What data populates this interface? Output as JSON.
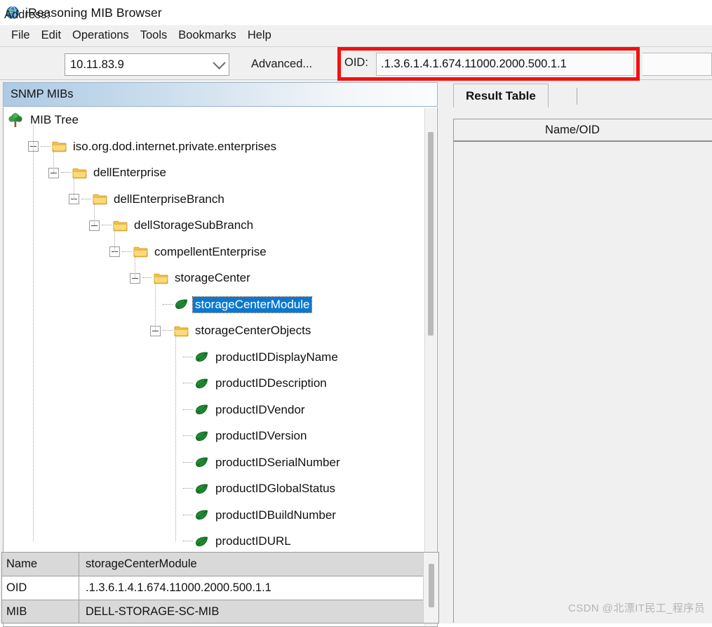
{
  "window": {
    "title": "iReasoning MIB Browser",
    "icon": "globe-icon"
  },
  "menubar": {
    "items": [
      {
        "label": "File"
      },
      {
        "label": "Edit"
      },
      {
        "label": "Operations"
      },
      {
        "label": "Tools"
      },
      {
        "label": "Bookmarks"
      },
      {
        "label": "Help"
      }
    ]
  },
  "toolbar": {
    "address_label": "Address:",
    "address_value": "10.11.83.9",
    "address_placeholder": "Address",
    "advanced_label": "Advanced...",
    "oid_label": "OID:",
    "oid_value": ".1.3.6.1.4.1.674.11000.2000.500.1.1",
    "oid_placeholder": "OID",
    "highlight_color": "#f50f0f"
  },
  "left_panel": {
    "tab_label": "SNMP MIBs",
    "tree": [
      {
        "label": "MIB Tree",
        "depth": 0,
        "icon": "tree-icon",
        "expander": "none",
        "selected": false
      },
      {
        "label": "iso.org.dod.internet.private.enterprises",
        "depth": 1,
        "icon": "folder-icon",
        "expander": "collapse",
        "selected": false
      },
      {
        "label": "dellEnterprise",
        "depth": 2,
        "icon": "folder-icon",
        "expander": "collapse",
        "selected": false
      },
      {
        "label": "dellEnterpriseBranch",
        "depth": 3,
        "icon": "folder-icon",
        "expander": "collapse",
        "selected": false
      },
      {
        "label": "dellStorageSubBranch",
        "depth": 4,
        "icon": "folder-icon",
        "expander": "collapse",
        "selected": false
      },
      {
        "label": "compellentEnterprise",
        "depth": 5,
        "icon": "folder-icon",
        "expander": "collapse",
        "selected": false
      },
      {
        "label": "storageCenter",
        "depth": 6,
        "icon": "folder-icon",
        "expander": "collapse",
        "selected": false
      },
      {
        "label": "storageCenterModule",
        "depth": 7,
        "icon": "leaf-icon",
        "expander": "none",
        "selected": true
      },
      {
        "label": "storageCenterObjects",
        "depth": 7,
        "icon": "folder-icon",
        "expander": "collapse",
        "selected": false
      },
      {
        "label": "productIDDisplayName",
        "depth": 8,
        "icon": "leaf-icon",
        "expander": "none",
        "selected": false
      },
      {
        "label": "productIDDescription",
        "depth": 8,
        "icon": "leaf-icon",
        "expander": "none",
        "selected": false
      },
      {
        "label": "productIDVendor",
        "depth": 8,
        "icon": "leaf-icon",
        "expander": "none",
        "selected": false
      },
      {
        "label": "productIDVersion",
        "depth": 8,
        "icon": "leaf-icon",
        "expander": "none",
        "selected": false
      },
      {
        "label": "productIDSerialNumber",
        "depth": 8,
        "icon": "leaf-icon",
        "expander": "none",
        "selected": false
      },
      {
        "label": "productIDGlobalStatus",
        "depth": 8,
        "icon": "leaf-icon",
        "expander": "none",
        "selected": false
      },
      {
        "label": "productIDBuildNumber",
        "depth": 8,
        "icon": "leaf-icon",
        "expander": "none",
        "selected": false
      },
      {
        "label": "productIDURL",
        "depth": 8,
        "icon": "leaf-icon",
        "expander": "none",
        "selected": false
      }
    ],
    "selection_color": "#0b78d0"
  },
  "detail_panel": {
    "rows": [
      {
        "key": "Name",
        "value": "storageCenterModule",
        "shade": "gray"
      },
      {
        "key": "OID",
        "value": ".1.3.6.1.4.1.674.11000.2000.500.1.1",
        "shade": "white"
      },
      {
        "key": "MIB",
        "value": "DELL-STORAGE-SC-MIB",
        "shade": "gray"
      }
    ]
  },
  "right_panel": {
    "tab_label": "Result Table",
    "table": {
      "columns": [
        "Name/OID"
      ],
      "rows": []
    }
  },
  "watermark": {
    "text": "CSDN @北漂IT民工_程序员"
  }
}
